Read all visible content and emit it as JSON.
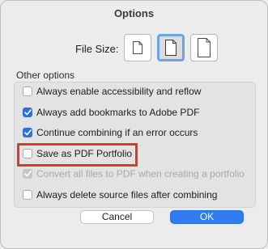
{
  "dialog": {
    "title": "Options",
    "file_size_label": "File Size:",
    "file_size_options": [
      {
        "icon": "small-page-icon",
        "selected": false
      },
      {
        "icon": "medium-page-icon",
        "selected": true
      },
      {
        "icon": "large-page-icon",
        "selected": false
      }
    ],
    "other_options_label": "Other options",
    "options": [
      {
        "label": "Always enable accessibility and reflow",
        "checked": false,
        "enabled": true
      },
      {
        "label": "Always add bookmarks to Adobe PDF",
        "checked": true,
        "enabled": true
      },
      {
        "label": "Continue combining if an error occurs",
        "checked": true,
        "enabled": true
      },
      {
        "label": "Save as PDF Portfolio",
        "checked": false,
        "enabled": true
      },
      {
        "label": "Convert all files to PDF when creating a portfolio",
        "checked": true,
        "enabled": false
      },
      {
        "label": "Always delete source files after combining",
        "checked": false,
        "enabled": true
      }
    ],
    "cancel_label": "Cancel",
    "ok_label": "OK"
  },
  "colors": {
    "accent": "#2f7cf0",
    "highlight_annotation": "#e0391f"
  }
}
